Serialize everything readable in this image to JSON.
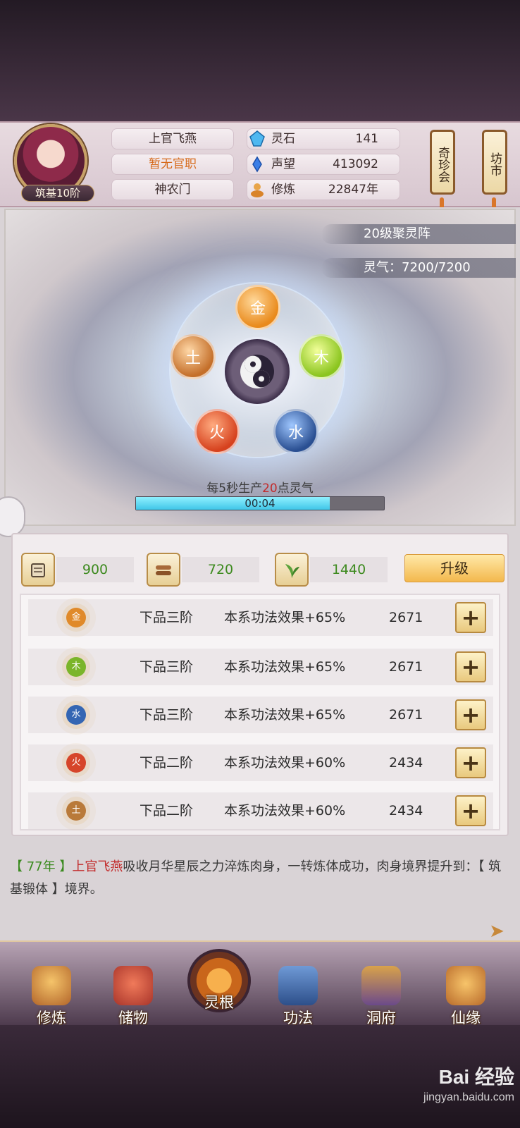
{
  "player": {
    "name": "上官飞燕",
    "title": "暂无官职",
    "sect": "神农门",
    "rank": "筑基10阶"
  },
  "stats": [
    {
      "icon": "spirit-stone-icon",
      "label": "灵石",
      "value": "141"
    },
    {
      "icon": "reputation-icon",
      "label": "声望",
      "value": "413092"
    },
    {
      "icon": "cultivation-icon",
      "label": "修炼",
      "value": "22847年"
    }
  ],
  "side_buttons": {
    "treasure": "奇珍会",
    "market": "坊市"
  },
  "array": {
    "level": "20级聚灵阵",
    "qi": "灵气：7200/7200",
    "elements": {
      "jin": "金",
      "mu": "木",
      "shui": "水",
      "huo": "火",
      "tu": "土"
    },
    "production_prefix": "每5秒生产",
    "production_amount": "20",
    "production_suffix": "点灵气",
    "timer": "00:04",
    "progress": 0.78
  },
  "resources": [
    {
      "icon": "scroll-icon",
      "value": "900"
    },
    {
      "icon": "wood-icon",
      "value": "720"
    },
    {
      "icon": "herb-icon",
      "value": "1440"
    }
  ],
  "upgrade_label": "升级",
  "roots": [
    {
      "element": "金",
      "color": "#e08a2a",
      "grade": "下品三阶",
      "effect": "本系功法效果+65%",
      "cost": "2671"
    },
    {
      "element": "木",
      "color": "#7bb52a",
      "grade": "下品三阶",
      "effect": "本系功法效果+65%",
      "cost": "2671"
    },
    {
      "element": "水",
      "color": "#3466b3",
      "grade": "下品三阶",
      "effect": "本系功法效果+65%",
      "cost": "2671"
    },
    {
      "element": "火",
      "color": "#d6452a",
      "grade": "下品二阶",
      "effect": "本系功法效果+60%",
      "cost": "2434"
    },
    {
      "element": "土",
      "color": "#b97a3a",
      "grade": "下品二阶",
      "effect": "本系功法效果+60%",
      "cost": "2434"
    }
  ],
  "log": {
    "year": "【 77年 】",
    "name": "上官飞燕",
    "text": "吸收月华星辰之力淬炼肉身，一转炼体成功，肉身境界提升到：【 筑基锻体 】境界。"
  },
  "nav": [
    {
      "label": "修炼",
      "icon": "cultivate-icon"
    },
    {
      "label": "储物",
      "icon": "storage-bag-icon"
    },
    {
      "label": "灵根",
      "icon": "spirit-root-icon"
    },
    {
      "label": "功法",
      "icon": "technique-book-icon"
    },
    {
      "label": "洞府",
      "icon": "cave-mansion-icon"
    },
    {
      "label": "仙缘",
      "icon": "immortal-fate-icon"
    }
  ],
  "watermark": {
    "main": "Bai 经验",
    "sub": "jingyan.baidu.com"
  },
  "colors": {
    "accent": "#f3b84d",
    "progress": "#3fc6e8",
    "highlight": "#c22a2a",
    "year": "#3a8a1f"
  }
}
